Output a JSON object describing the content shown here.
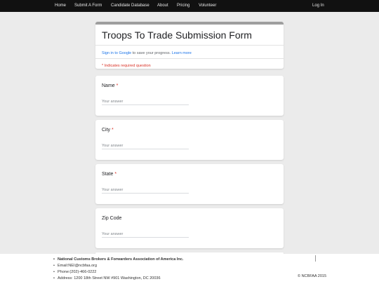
{
  "navbar": {
    "items": [
      "Home",
      "Submit A Form",
      "Candidate Database",
      "About",
      "Pricing",
      "Volunteer"
    ],
    "login_label": "Log In"
  },
  "form": {
    "title": "Troops To Trade Submission Form",
    "signin_link": "Sign in to Google",
    "signin_text": " to save your progress. ",
    "learn_more": "Learn more",
    "required_note": "* Indicates required question",
    "questions": [
      {
        "label": "Name",
        "required": "*",
        "placeholder": "Your answer"
      },
      {
        "label": "City",
        "required": "*",
        "placeholder": "Your answer"
      },
      {
        "label": "State",
        "required": "*",
        "placeholder": "Your answer"
      },
      {
        "label": "Zip Code",
        "required": "",
        "placeholder": "Your answer"
      }
    ]
  },
  "footer": {
    "org_name": "National Customs Brokers & Forwarders Association of America Inc.",
    "email": "Email:NEI@ncbfaa.org",
    "phone": "Phone:(202)-466-0222",
    "address": "Address: 1200 18th Street NW #901 Washington, DC 20036",
    "copyright": "© NCBFAA 2015"
  },
  "colors": {
    "navbar_bg": "#111111",
    "page_bg": "#ebebeb",
    "header_accent": "#9e9e9e",
    "required": "#d93025",
    "link": "#1a73e8"
  }
}
